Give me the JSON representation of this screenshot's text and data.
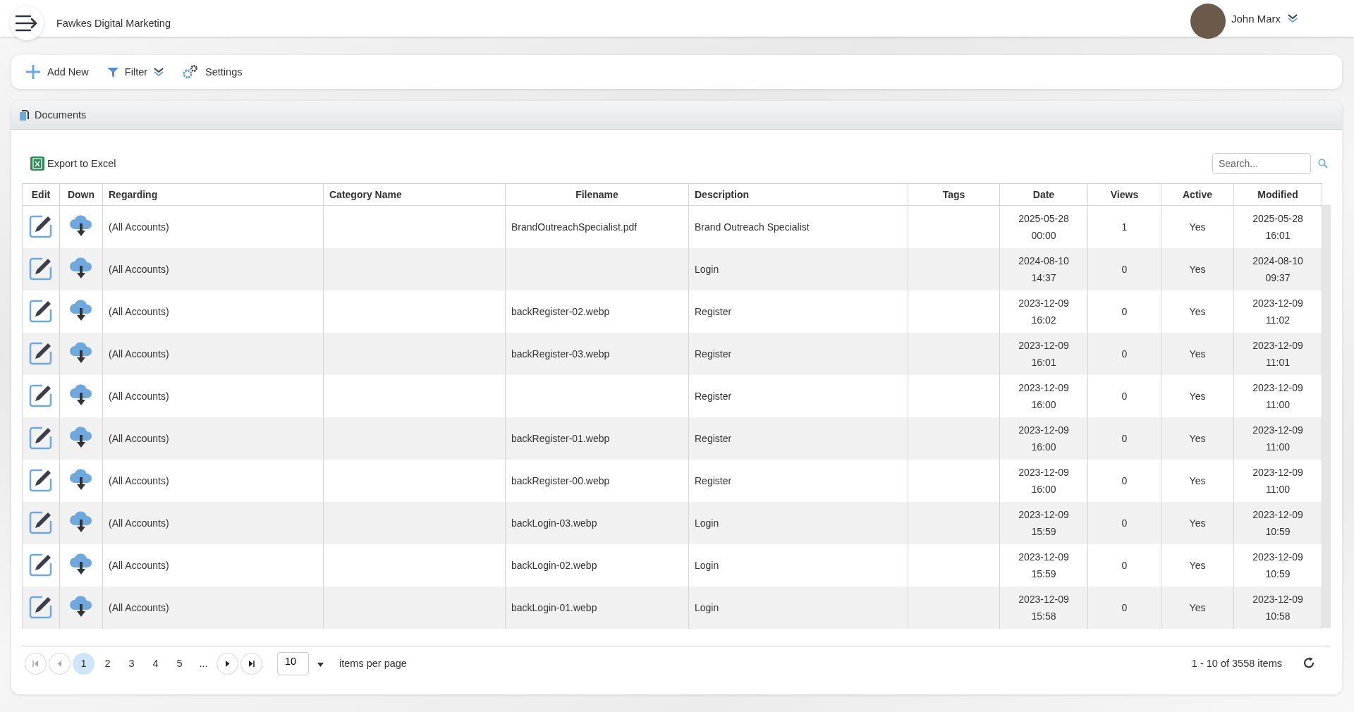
{
  "header": {
    "company": "Fawkes Digital Marketing",
    "user": "John Marx"
  },
  "toolbar": [
    {
      "kind": "add",
      "label": "Add New"
    },
    {
      "kind": "filter",
      "label": "Filter"
    },
    {
      "kind": "settings",
      "label": "Settings"
    }
  ],
  "panel": {
    "title": "Documents",
    "export_label": "Export to Excel",
    "search": {
      "placeholder": "Search..."
    }
  },
  "table": {
    "columns": [
      {
        "label": "Edit"
      },
      {
        "label": "Down"
      },
      {
        "label": "Regarding"
      },
      {
        "label": "Category Name"
      },
      {
        "label": "Filename"
      },
      {
        "label": "Description"
      },
      {
        "label": "Tags"
      },
      {
        "label": "Date"
      },
      {
        "label": "Views"
      },
      {
        "label": "Active"
      },
      {
        "label": "Modified"
      }
    ],
    "rows": [
      {
        "regarding": "(All Accounts)",
        "filename": "BrandOutreachSpecialist.pdf",
        "description": "Brand Outreach Specialist",
        "date": "2025-05-28 00:00",
        "views": "1",
        "active": "Yes",
        "modified": "2025-05-28 16:01"
      },
      {
        "regarding": "(All Accounts)",
        "description": "Login",
        "date": "2024-08-10 14:37",
        "views": "0",
        "active": "Yes",
        "modified": "2024-08-10 09:37"
      },
      {
        "regarding": "(All Accounts)",
        "filename": "backRegister-02.webp",
        "description": "Register",
        "date": "2023-12-09 16:02",
        "views": "0",
        "active": "Yes",
        "modified": "2023-12-09 11:02"
      },
      {
        "regarding": "(All Accounts)",
        "filename": "backRegister-03.webp",
        "description": "Register",
        "date": "2023-12-09 16:01",
        "views": "0",
        "active": "Yes",
        "modified": "2023-12-09 11:01"
      },
      {
        "regarding": "(All Accounts)",
        "description": "Register",
        "date": "2023-12-09 16:00",
        "views": "0",
        "active": "Yes",
        "modified": "2023-12-09 11:00"
      },
      {
        "regarding": "(All Accounts)",
        "filename": "backRegister-01.webp",
        "description": "Register",
        "date": "2023-12-09 16:00",
        "views": "0",
        "active": "Yes",
        "modified": "2023-12-09 11:00"
      },
      {
        "regarding": "(All Accounts)",
        "filename": "backRegister-00.webp",
        "description": "Register",
        "date": "2023-12-09 16:00",
        "views": "0",
        "active": "Yes",
        "modified": "2023-12-09 11:00"
      },
      {
        "regarding": "(All Accounts)",
        "filename": "backLogin-03.webp",
        "description": "Login",
        "date": "2023-12-09 15:59",
        "views": "0",
        "active": "Yes",
        "modified": "2023-12-09 10:59"
      },
      {
        "regarding": "(All Accounts)",
        "filename": "backLogin-02.webp",
        "description": "Login",
        "date": "2023-12-09 15:59",
        "views": "0",
        "active": "Yes",
        "modified": "2023-12-09 10:59"
      },
      {
        "regarding": "(All Accounts)",
        "filename": "backLogin-01.webp",
        "description": "Login",
        "date": "2023-12-09 15:58",
        "views": "0",
        "active": "Yes",
        "modified": "2023-12-09 10:58"
      }
    ]
  },
  "pager": {
    "pages": [
      {
        "label": "1",
        "selected": true
      },
      {
        "label": "2",
        "selected": false
      },
      {
        "label": "3",
        "selected": false
      },
      {
        "label": "4",
        "selected": false
      },
      {
        "label": "5",
        "selected": false
      }
    ],
    "ellipsis": "...",
    "page_size": "10",
    "page_size_label": "items per page",
    "summary": "1 - 10 of 3558 items"
  }
}
